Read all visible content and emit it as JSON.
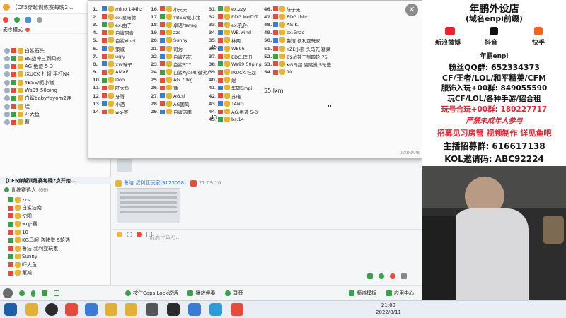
{
  "left": {
    "title": "【CF5穿越训练赛每晚2...",
    "sort_label": "麦序模式",
    "members": [
      "白鲨石头",
      "BS战神三到四轮",
      "AG 绝迹 5-3",
      "IXUCK 杜超 平打N4",
      "YBSS/昵小猪",
      "Wa99 50ping",
      "白鲨baby*ayom2连",
      "煜",
      "吓大鱼",
      "曹"
    ],
    "room2_title": "【CF5穿越训练赛每晚?点开始...",
    "room2_sub": "训练赛选人",
    "room2_count": "(66)",
    "room2_members": [
      "zzs",
      "白鲨洁南",
      "沈阳",
      "wqj-赛",
      "10",
      "KG马超 咨赌觉 5轮选",
      "鲁洁 叔利亚玩家",
      "Sunny",
      "吓大鱼",
      "策减"
    ]
  },
  "popup": {
    "close": "✕",
    "col1": {
      "start": 1,
      "items": [
        "mino 144hz",
        "ex.星马德",
        "ex.曲子",
        "白鲨阿肯",
        "白鲨xinbi",
        "策减",
        "ugly",
        "XW瑞子",
        "AMXE",
        "Doo",
        "吓大鱼",
        "牙哥",
        "小洒",
        "wq-赛"
      ]
    },
    "col2": {
      "start": 16,
      "items": [
        "小天天",
        "YBSS/昵小猪",
        "卓语*swag",
        "zzs",
        "Sunny",
        "司为",
        "白鲨石花",
        "白鲨577",
        "白鲨AyaM('微笑)",
        "AG.70kg",
        "豫",
        "AG.sl",
        "AG国风",
        "白鲨洁南"
      ]
    },
    "col3": {
      "start": 31,
      "items": [
        "ex.zzy",
        "EDG.MoTnT",
        "ex.孔孙",
        "WE.wind",
        "林两",
        "WE96",
        "EDG.理旧",
        "Wa99 50ping",
        "IXUCK 杜超",
        "煜",
        "华硕5mpi",
        "苏瑞",
        "TANG",
        "AG.绝迹 5-3",
        "bs.14"
      ]
    },
    "col4": {
      "start": 46,
      "items": [
        "陈子无",
        "EDG.thhh",
        "AG.K.",
        "ex.Enze",
        "鲁洁 叔利亚玩家",
        "YZE小熊 头马先·糖果",
        "BS战神三到四轮 75",
        "KG马超 咨赌觉 5轮选",
        "10"
      ]
    },
    "mid_numbers": [
      "35.",
      "43."
    ],
    "extra": "55.lxm",
    "watermark": "UI/ABNAME"
  },
  "chat": {
    "sender": "鲁洁 叔利亚玩家(9123058)",
    "time": "21:09:10",
    "input_placeholder": "说点什么吧...",
    "send": "发送"
  },
  "toolbar": {
    "hold_key": "按住Caps Lock说话",
    "play_music": "播放伴奏",
    "record": "录音",
    "channel_mode": "频道模板",
    "app_center": "应用中心"
  },
  "right": {
    "brand": "年鹏外设店",
    "brand_sub": "(域名enpi前缀)",
    "weibo": "新浪微博",
    "douyin": "抖音",
    "kuaishou": "快手",
    "handle": "年鹏enpi",
    "fans_qq": "粉丝QQ群: 652334373",
    "games": "CF/王者/LOL/和平精英/CFM",
    "group1": "服饰入玩+00群: 849055590",
    "games2": "玩CF/LOL/各种手游/招合租",
    "group2": "玩号合玩+00群: 180227717",
    "warning": "严禁未成年人参与",
    "recruit": "招募见习房管 视频制作 详见鱼吧",
    "anchor": "主播招募群: 616617138",
    "kol": "KOL邀请码: ABC92224"
  },
  "taskbar": {
    "time": "21:09",
    "date": "2022/8/11"
  },
  "colors": {
    "accent": "#2a6bd8",
    "red": "#e8222f",
    "gold": "#e9b52f",
    "green": "#3aa14a"
  }
}
